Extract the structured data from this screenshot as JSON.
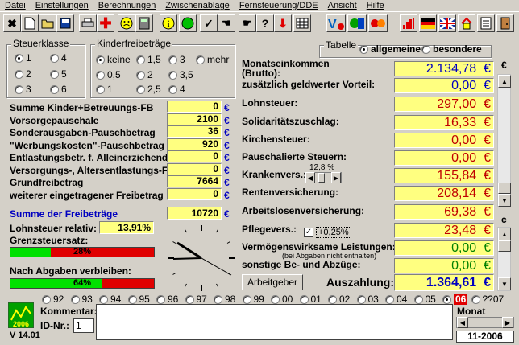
{
  "menu": [
    "Datei",
    "Einstellungen",
    "Berechnungen",
    "Zwischenablage",
    "Fernsteuerung/DDE",
    "Ansicht",
    "Hilfe"
  ],
  "toolbar": {
    "icons": [
      "close-icon",
      "new-file-icon",
      "open-folder-icon",
      "save-icon",
      "print-icon",
      "plus-red-icon",
      "smiley-icon",
      "calculator-icon",
      "info-icon",
      "green-circle-icon",
      "check-icon",
      "hand-icon",
      "pointer-hand-icon",
      "help-icon",
      "arrow-down-icon",
      "grid-icon"
    ],
    "help_glyph": "?",
    "info_glyph": "i",
    "right_icons": [
      "chart-icon",
      "flag-germany-icon",
      "flag-uk-icon",
      "home-icon",
      "list-icon",
      "door-icon"
    ]
  },
  "steuerklasse": {
    "title": "Steuerklasse",
    "options": [
      "1",
      "2",
      "3",
      "4",
      "5",
      "6"
    ],
    "selected": "1"
  },
  "kinder": {
    "title": "Kinderfreibeträge",
    "options": [
      "keine",
      "1,5",
      "3",
      "mehr",
      "0,5",
      "2",
      "3,5",
      "1",
      "2,5",
      "4"
    ],
    "selected": "keine"
  },
  "tabelle": {
    "title": "Tabelle",
    "options": [
      "allgemeine",
      "besondere"
    ],
    "selected": "allgemeine"
  },
  "left": {
    "rows": [
      {
        "label": "Summe Kinder+Betreuungs-FB",
        "value": "0",
        "unit": "€"
      },
      {
        "label": "Vorsorgepauschale",
        "value": "2100",
        "unit": "€"
      },
      {
        "label": "Sonderausgaben-Pauschbetrag",
        "value": "36",
        "unit": "€"
      },
      {
        "label": "\"Werbungskosten\"-Pauschbetrag",
        "value": "920",
        "unit": "€"
      },
      {
        "label": "Entlastungsbetr. f. Alleinerziehende",
        "value": "0",
        "unit": "€"
      },
      {
        "label": "Versorgungs-, Altersentlastungs-FB",
        "value": "0",
        "unit": "€"
      },
      {
        "label": "Grundfreibetrag",
        "value": "7664",
        "unit": "€"
      },
      {
        "label": "weiterer eingetragener Freibetrag",
        "value": "0",
        "unit": "€"
      }
    ],
    "summe_label": "Summe der Freibeträge",
    "summe_value": "10720",
    "summe_unit": "€",
    "lohnsteuer_rel_label": "Lohnsteuer relativ:",
    "lohnsteuer_rel_value": "13,91%",
    "grenz_label": "Grenzsteuersatz:",
    "grenz_value": "28%",
    "grenz_fraction": 0.28,
    "nach_label": "Nach Abgaben verbleiben:",
    "nach_value": "64%",
    "nach_fraction": 0.64
  },
  "right": {
    "rows": [
      {
        "label": "Monatseinkommen",
        "sub": "(Brutto):",
        "value": "2.134,78",
        "unit": "€",
        "color": "#0000c0"
      },
      {
        "label": "zusätzlich geldwerter Vorteil:",
        "value": "0,00",
        "unit": "€",
        "color": "#0000c0"
      },
      {
        "label": "Lohnsteuer:",
        "value": "297,00",
        "unit": "€",
        "color": "#c00000"
      },
      {
        "label": "Solidaritätszuschlag:",
        "value": "16,33",
        "unit": "€",
        "color": "#c00000"
      },
      {
        "label": "Kirchensteuer:",
        "value": "0,00",
        "unit": "€",
        "color": "#c00000"
      },
      {
        "label": "Pauschalierte Steuern:",
        "value": "0,00",
        "unit": "€",
        "color": "#c00000"
      },
      {
        "label": "Krankenvers.:",
        "value": "155,84",
        "unit": "€",
        "color": "#c00000"
      },
      {
        "label": "Rentenversicherung:",
        "value": "208,14",
        "unit": "€",
        "color": "#c00000"
      },
      {
        "label": "Arbeitslosenversicherung:",
        "value": "69,38",
        "unit": "€",
        "color": "#c00000"
      },
      {
        "label": "Pflegevers.:",
        "value": "23,48",
        "unit": "€",
        "color": "#c00000"
      },
      {
        "label": "Vermögenswirksame Leistungen:",
        "value": "0,00",
        "unit": "€",
        "color": "#008000"
      },
      {
        "label": "sonstige Be- und Abzüge:",
        "value": "0,00",
        "unit": "€",
        "color": "#008000"
      }
    ],
    "kranken_rate": "12,8 %",
    "pflege_check": "+0,25%",
    "verm_note": "(bei Abgaben nicht enthalten)",
    "arbeitgeber_button": "Arbeitgeber",
    "auszahlung_label": "Auszahlung:",
    "auszahlung_value": "1.364,61",
    "auszahlung_unit": "€"
  },
  "scroll": {
    "euro_label": "€",
    "c_label": "c"
  },
  "years": {
    "options": [
      "92",
      "93",
      "94",
      "95",
      "96",
      "97",
      "98",
      "99",
      "00",
      "01",
      "02",
      "03",
      "04",
      "05",
      "06",
      "??07"
    ],
    "selected": "06"
  },
  "bottom": {
    "logo_text": "2006",
    "version": "V 14.01",
    "kommentar_label": "Kommentar:",
    "id_label": "ID-Nr.:",
    "id_value": "1",
    "monat_label": "Monat",
    "monat_value": "11-2006"
  }
}
